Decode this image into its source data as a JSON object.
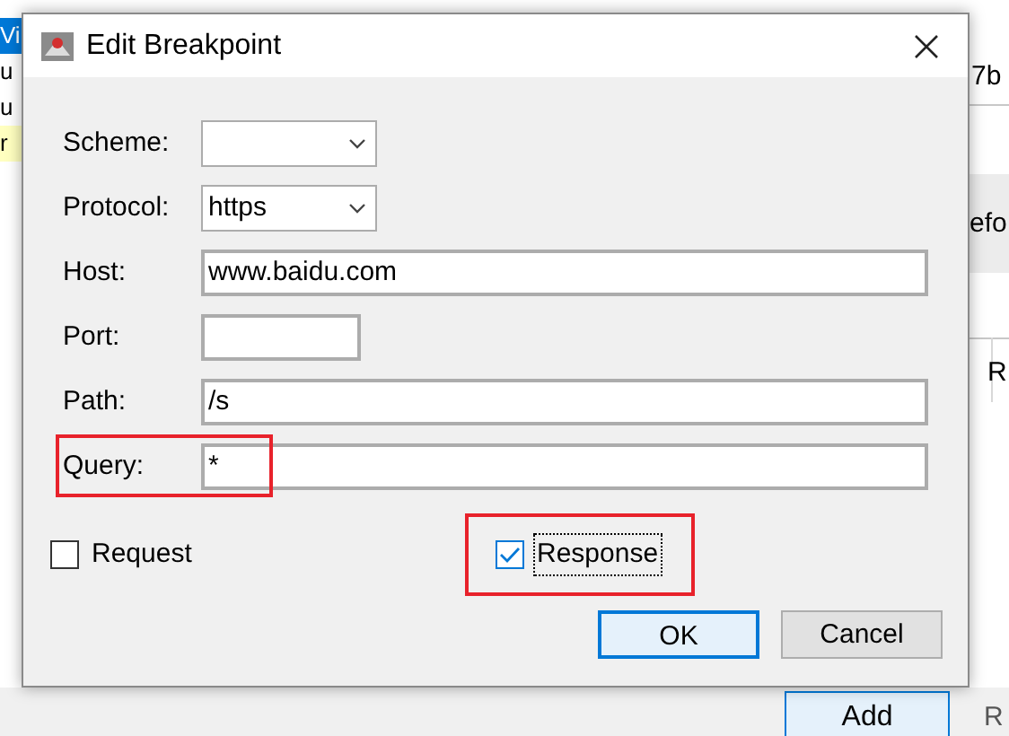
{
  "background": {
    "left_items": [
      {
        "text": "Vi",
        "selected": true,
        "highlighted": false
      },
      {
        "text": "u",
        "selected": false,
        "highlighted": false
      },
      {
        "text": "u",
        "selected": false,
        "highlighted": false
      },
      {
        "text": "r",
        "selected": false,
        "highlighted": true
      }
    ],
    "right_fragments": [
      "7b",
      "efo",
      "R"
    ],
    "add_button": "Add",
    "bottom_fragment": "R"
  },
  "dialog": {
    "title": "Edit Breakpoint",
    "fields": [
      {
        "kind": "dropdown",
        "label": "Scheme:",
        "highlighted": false
      },
      {
        "kind": "dropdown",
        "label": "Protocol:",
        "value": "https",
        "highlighted": false
      },
      {
        "kind": "text",
        "label": "Host:",
        "value": "www.baidu.com",
        "highlighted": false
      },
      {
        "kind": "short",
        "label": "Port:",
        "highlighted": false
      },
      {
        "kind": "text",
        "label": "Path:",
        "value": "/s",
        "highlighted": false
      },
      {
        "kind": "text",
        "label": "Query:",
        "value": "*",
        "highlighted": true
      }
    ],
    "checkboxes": [
      {
        "label": "Request",
        "checked": false,
        "focused": false,
        "highlighted": false
      },
      {
        "label": "Response",
        "checked": true,
        "focused": true,
        "highlighted": true
      }
    ],
    "buttons": [
      {
        "label": "OK",
        "default": true
      },
      {
        "label": "Cancel",
        "default": false
      }
    ]
  }
}
